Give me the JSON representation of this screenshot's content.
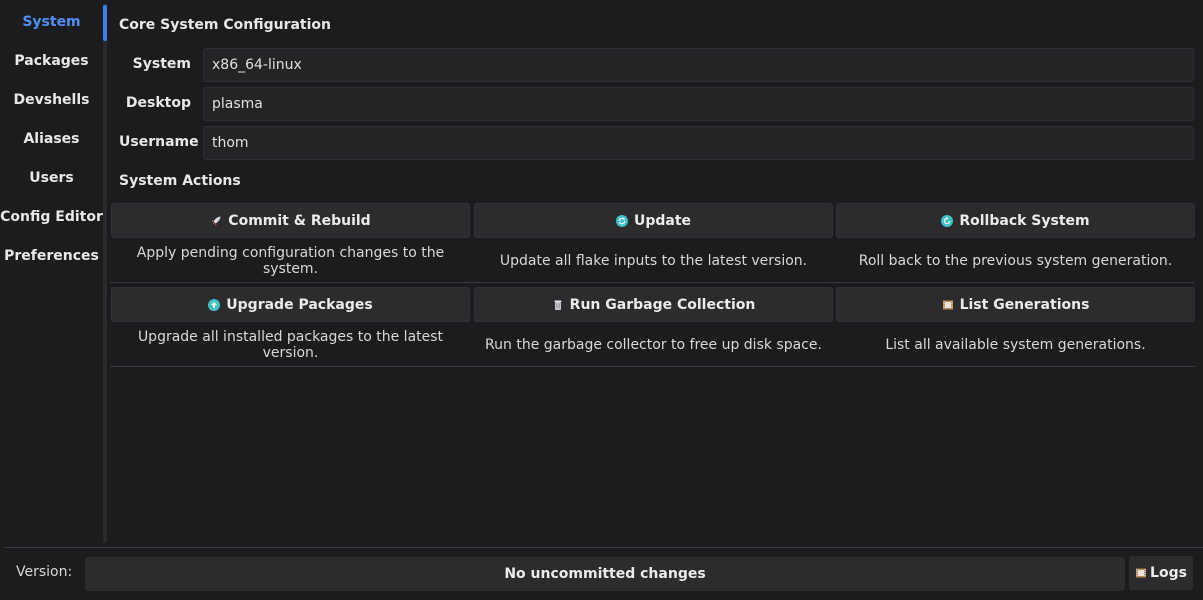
{
  "sidebar": {
    "items": [
      {
        "label": "System",
        "active": true
      },
      {
        "label": "Packages"
      },
      {
        "label": "Devshells"
      },
      {
        "label": "Aliases"
      },
      {
        "label": "Users"
      },
      {
        "label": "Config Editor"
      },
      {
        "label": "Preferences"
      }
    ]
  },
  "config": {
    "title": "Core System Configuration",
    "fields": [
      {
        "label": "System",
        "value": "x86_64-linux"
      },
      {
        "label": "Desktop",
        "value": "plasma"
      },
      {
        "label": "Username",
        "value": "thom"
      }
    ]
  },
  "actions": {
    "title": "System Actions",
    "items": [
      {
        "label": "Commit & Rebuild",
        "icon": "rocket-icon",
        "description": "Apply pending configuration changes to the system."
      },
      {
        "label": "Update",
        "icon": "refresh-icon",
        "description": "Update all flake inputs to the latest version."
      },
      {
        "label": "Rollback System",
        "icon": "rollback-icon",
        "description": "Roll back to the previous system generation."
      },
      {
        "label": "Upgrade Packages",
        "icon": "upgrade-icon",
        "description": "Upgrade all installed packages to the latest version."
      },
      {
        "label": "Run Garbage Collection",
        "icon": "trash-icon",
        "description": "Run the garbage collector to free up disk space."
      },
      {
        "label": "List Generations",
        "icon": "film-icon",
        "description": "List all available system generations."
      }
    ]
  },
  "footer": {
    "version_label": "Version:",
    "status": "No uncommitted changes",
    "logs_label": "Logs"
  },
  "colors": {
    "accent": "#3d7ff0",
    "background": "#1c1c1e",
    "button": "#2c2c2f"
  }
}
